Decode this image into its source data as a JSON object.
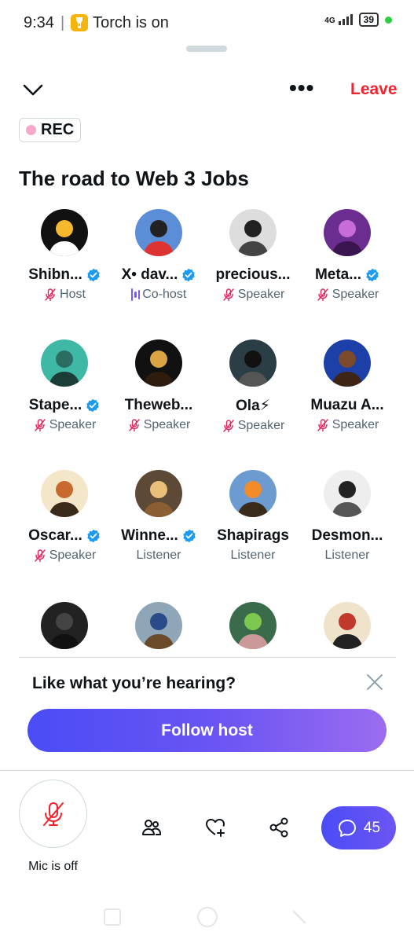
{
  "status_bar": {
    "time": "9:34",
    "notification": "Torch is on",
    "network": "4G",
    "battery": "39"
  },
  "header": {
    "collapse_icon": "chevron-down-icon",
    "more_icon": "more-dots-icon",
    "leave_label": "Leave"
  },
  "rec_badge": "REC",
  "space_title": "The road to Web 3 Jobs",
  "participants": [
    {
      "name": "Shibn...",
      "verified": true,
      "role": "Host",
      "role_icon": "mic-off-icon"
    },
    {
      "name": "X• dav...",
      "verified": true,
      "role": "Co-host",
      "role_icon": "speaking-bars-icon"
    },
    {
      "name": "precious...",
      "verified": false,
      "role": "Speaker",
      "role_icon": "mic-off-icon"
    },
    {
      "name": "Meta...",
      "verified": true,
      "role": "Speaker",
      "role_icon": "mic-off-icon"
    },
    {
      "name": "Stape...",
      "verified": true,
      "role": "Speaker",
      "role_icon": "mic-off-icon"
    },
    {
      "name": "Theweb...",
      "verified": false,
      "role": "Speaker",
      "role_icon": "mic-off-icon"
    },
    {
      "name": "Ola⚡",
      "verified": false,
      "role": "Speaker",
      "role_icon": "mic-off-icon"
    },
    {
      "name": "Muazu A...",
      "verified": false,
      "role": "Speaker",
      "role_icon": "mic-off-icon"
    },
    {
      "name": "Oscar...",
      "verified": true,
      "role": "Speaker",
      "role_icon": "mic-off-icon"
    },
    {
      "name": "Winne...",
      "verified": true,
      "role": "Listener",
      "role_icon": ""
    },
    {
      "name": "Shapirags",
      "verified": false,
      "role": "Listener",
      "role_icon": ""
    },
    {
      "name": "Desmon...",
      "verified": false,
      "role": "Listener",
      "role_icon": ""
    },
    {
      "name": "",
      "verified": false,
      "role": "",
      "role_icon": ""
    },
    {
      "name": "",
      "verified": false,
      "role": "",
      "role_icon": ""
    },
    {
      "name": "",
      "verified": false,
      "role": "",
      "role_icon": ""
    },
    {
      "name": "",
      "verified": false,
      "role": "",
      "role_icon": ""
    }
  ],
  "follow_prompt": {
    "text": "Like what you’re hearing?",
    "button": "Follow host",
    "close_icon": "close-icon"
  },
  "bottom_bar": {
    "mic_label": "Mic is off",
    "chat_count": "45"
  },
  "colors": {
    "accent_gradient_start": "#4a4cf5",
    "accent_gradient_end": "#9b6cf0",
    "leave_red": "#f4212e",
    "verified_blue": "#1d9bf0",
    "mic_off_pink": "#e0245e",
    "cohost_purple": "#7856ff"
  }
}
